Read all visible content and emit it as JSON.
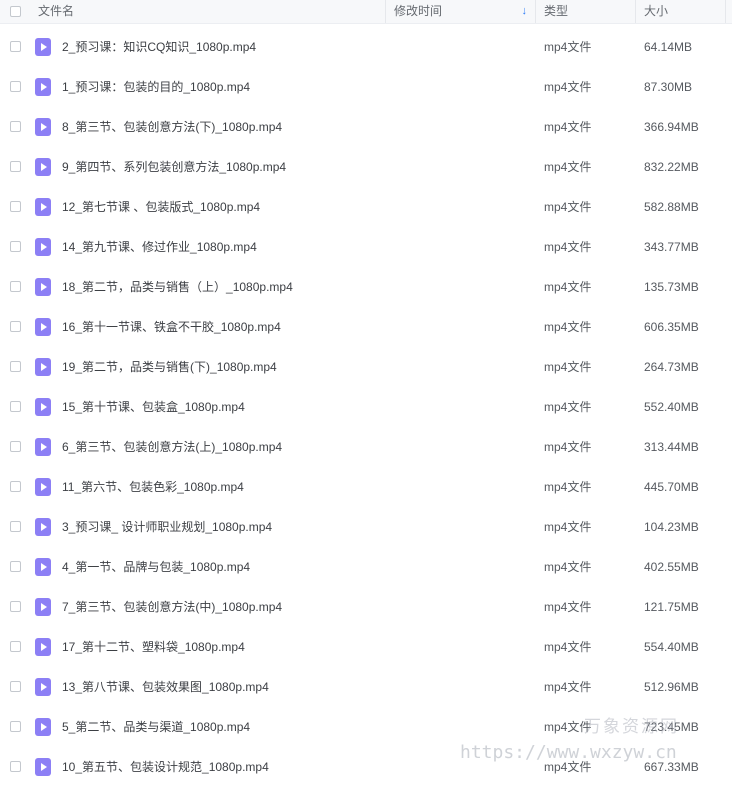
{
  "header": {
    "name": "文件名",
    "time": "修改时间",
    "sort_icon": "↓",
    "type": "类型",
    "size": "大小"
  },
  "files": [
    {
      "name": "2_预习课：知识CQ知识_1080p.mp4",
      "type": "mp4文件",
      "size": "64.14MB"
    },
    {
      "name": "1_预习课：包装的目的_1080p.mp4",
      "type": "mp4文件",
      "size": "87.30MB"
    },
    {
      "name": "8_第三节、包装创意方法(下)_1080p.mp4",
      "type": "mp4文件",
      "size": "366.94MB"
    },
    {
      "name": "9_第四节、系列包装创意方法_1080p.mp4",
      "type": "mp4文件",
      "size": "832.22MB"
    },
    {
      "name": "12_第七节课 、包装版式_1080p.mp4",
      "type": "mp4文件",
      "size": "582.88MB"
    },
    {
      "name": "14_第九节课、修过作业_1080p.mp4",
      "type": "mp4文件",
      "size": "343.77MB"
    },
    {
      "name": "18_第二节，品类与销售（上）_1080p.mp4",
      "type": "mp4文件",
      "size": "135.73MB"
    },
    {
      "name": "16_第十一节课、铁盒不干胶_1080p.mp4",
      "type": "mp4文件",
      "size": "606.35MB"
    },
    {
      "name": "19_第二节，品类与销售(下)_1080p.mp4",
      "type": "mp4文件",
      "size": "264.73MB"
    },
    {
      "name": "15_第十节课、包装盒_1080p.mp4",
      "type": "mp4文件",
      "size": "552.40MB"
    },
    {
      "name": "6_第三节、包装创意方法(上)_1080p.mp4",
      "type": "mp4文件",
      "size": "313.44MB"
    },
    {
      "name": "11_第六节、包装色彩_1080p.mp4",
      "type": "mp4文件",
      "size": "445.70MB"
    },
    {
      "name": "3_预习课_ 设计师职业规划_1080p.mp4",
      "type": "mp4文件",
      "size": "104.23MB"
    },
    {
      "name": "4_第一节、品牌与包装_1080p.mp4",
      "type": "mp4文件",
      "size": "402.55MB"
    },
    {
      "name": "7_第三节、包装创意方法(中)_1080p.mp4",
      "type": "mp4文件",
      "size": "121.75MB"
    },
    {
      "name": "17_第十二节、塑料袋_1080p.mp4",
      "type": "mp4文件",
      "size": "554.40MB"
    },
    {
      "name": "13_第八节课、包装效果图_1080p.mp4",
      "type": "mp4文件",
      "size": "512.96MB"
    },
    {
      "name": "5_第二节、品类与渠道_1080p.mp4",
      "type": "mp4文件",
      "size": "723.45MB"
    },
    {
      "name": "10_第五节、包装设计规范_1080p.mp4",
      "type": "mp4文件",
      "size": "667.33MB"
    }
  ],
  "watermark": {
    "logo": "万象资源网",
    "url": "https://www.wxzyw.cn"
  },
  "colors": {
    "icon": "#8c7ff5",
    "sort_arrow": "#2f7cf6"
  },
  "icons": {
    "file": "video-file-icon",
    "checkbox": "checkbox-icon",
    "sort": "sort-desc-icon"
  }
}
